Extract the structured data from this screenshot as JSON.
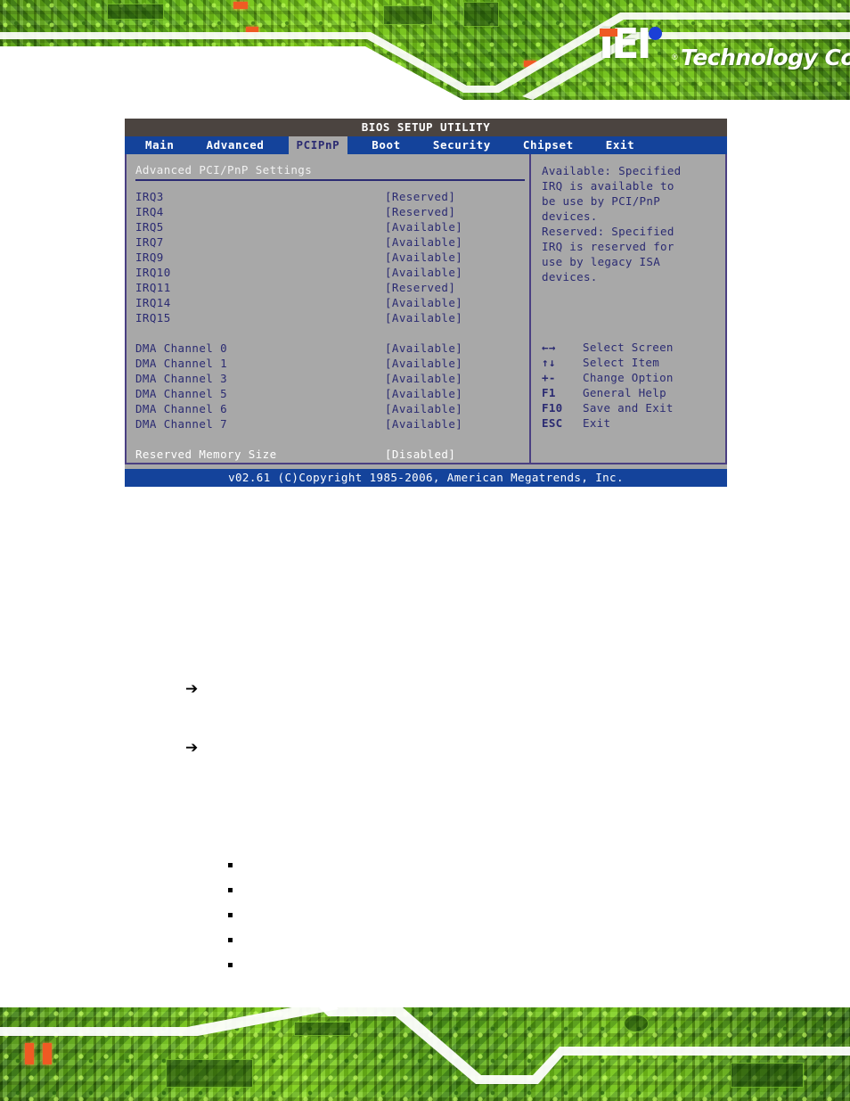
{
  "brand": {
    "logo_mark": "IEI",
    "logo_tm": "®",
    "logo_text": "Technology Corp.",
    "accent_green": "#7fd41a",
    "accent_orange": "#ef5a23",
    "accent_blue": "#1b3fd6"
  },
  "bios": {
    "title": "BIOS SETUP UTILITY",
    "footer": "v02.61 (C)Copyright 1985-2006, American Megatrends, Inc.",
    "tabs": [
      {
        "label": "Main",
        "active": false
      },
      {
        "label": "Advanced",
        "active": false
      },
      {
        "label": "PCIPnP",
        "active": true
      },
      {
        "label": "Boot",
        "active": false
      },
      {
        "label": "Security",
        "active": false
      },
      {
        "label": "Chipset",
        "active": false
      },
      {
        "label": "Exit",
        "active": false
      }
    ],
    "section_heading": "Advanced PCI/PnP Settings",
    "settings": [
      {
        "label": "IRQ3",
        "value": "[Reserved]",
        "selected": false
      },
      {
        "label": "IRQ4",
        "value": "[Reserved]",
        "selected": false
      },
      {
        "label": "IRQ5",
        "value": "[Available]",
        "selected": false
      },
      {
        "label": "IRQ7",
        "value": "[Available]",
        "selected": false
      },
      {
        "label": "IRQ9",
        "value": "[Available]",
        "selected": false
      },
      {
        "label": "IRQ10",
        "value": "[Available]",
        "selected": false
      },
      {
        "label": "IRQ11",
        "value": "[Reserved]",
        "selected": false
      },
      {
        "label": "IRQ14",
        "value": "[Available]",
        "selected": false
      },
      {
        "label": "IRQ15",
        "value": "[Available]",
        "selected": false
      }
    ],
    "dma_settings": [
      {
        "label": "DMA Channel 0",
        "value": "[Available]",
        "selected": false
      },
      {
        "label": "DMA Channel 1",
        "value": "[Available]",
        "selected": false
      },
      {
        "label": "DMA Channel 3",
        "value": "[Available]",
        "selected": false
      },
      {
        "label": "DMA Channel 5",
        "value": "[Available]",
        "selected": false
      },
      {
        "label": "DMA Channel 6",
        "value": "[Available]",
        "selected": false
      },
      {
        "label": "DMA Channel 7",
        "value": "[Available]",
        "selected": false
      }
    ],
    "memory_setting": {
      "label": "Reserved Memory Size",
      "value": "[Disabled]",
      "selected": true
    },
    "help_lines": [
      "Available: Specified",
      "IRQ is available to",
      "be use by PCI/PnP",
      "devices.",
      "Reserved: Specified",
      "IRQ is reserved for",
      "use by legacy ISA",
      "devices."
    ],
    "key_legend": [
      {
        "key": "←→",
        "desc": "Select Screen"
      },
      {
        "key": "↑↓",
        "desc": "Select Item"
      },
      {
        "key": "+-",
        "desc": "Change Option"
      },
      {
        "key": "F1",
        "desc": "General Help"
      },
      {
        "key": "F10",
        "desc": "Save and Exit"
      },
      {
        "key": "ESC",
        "desc": "Exit"
      }
    ]
  },
  "document_body": {
    "arrow_bullets": [
      {
        "glyph": "➔",
        "text": ""
      },
      {
        "glyph": "➔",
        "text": ""
      }
    ],
    "square_bullets": [
      {
        "text": ""
      },
      {
        "text": ""
      },
      {
        "text": ""
      },
      {
        "text": ""
      },
      {
        "text": ""
      }
    ]
  }
}
